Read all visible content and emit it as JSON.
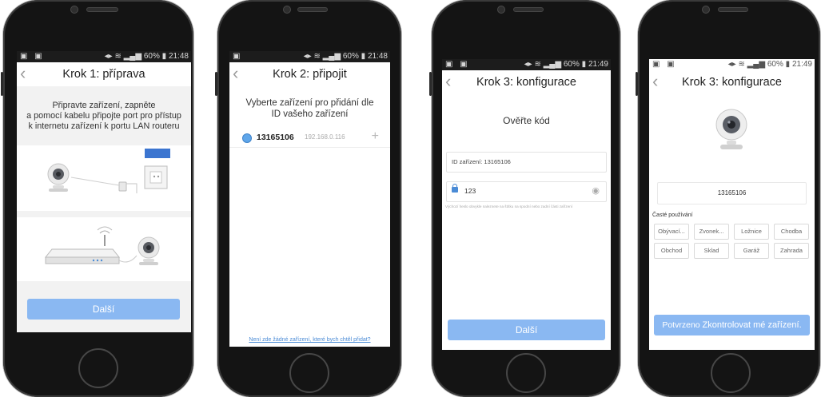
{
  "status": {
    "left_icons": "▣ ▣",
    "right_icons": "◂▸ ≋ ▂▄▆",
    "battery": "60%"
  },
  "screens": [
    {
      "time": "21:48",
      "title": "Krok 1: příprava",
      "instructions": [
        "Připravte zařízení, zapněte",
        "a pomocí kabelu připojte port pro přístup",
        "k internetu zařízení k portu LAN routeru"
      ],
      "next_label": "Další"
    },
    {
      "time": "21:48",
      "title": "Krok 2: připojit",
      "subtitle_lines": [
        "Vyberte zařízení pro přidání dle",
        "ID vašeho zařízení"
      ],
      "device": {
        "id": "13165106",
        "ip": "192.168.0.116"
      },
      "footer_link": "Není zde žádné zařízení, které bych chtěl přidat?"
    },
    {
      "time": "21:49",
      "title": "Krok 3: konfigurace",
      "heading": "Ověřte kód",
      "device_id_label": "ID zařízení: 13165106",
      "code_value": "123",
      "hint": "Výchozí heslo obvykle naleznete na štítku na spodní nebo zadní části zařízení",
      "next_label": "Další"
    },
    {
      "time": "21:49",
      "title": "Krok 3: konfigurace",
      "device_name": "13165106",
      "frequent_label": "Časté používání",
      "tags": [
        "Obývací...",
        "Zvonek...",
        "Ložnice",
        "Chodba",
        "Obchod",
        "Sklad",
        "Garáž",
        "Zahrada"
      ],
      "confirm_label": "Potvrzeno",
      "check_label": "Zkontrolovat mé zařízení."
    }
  ],
  "colors": {
    "accent": "#8ab8f2",
    "link": "#4a8bd6",
    "status_bar": "#1c1c1c"
  }
}
